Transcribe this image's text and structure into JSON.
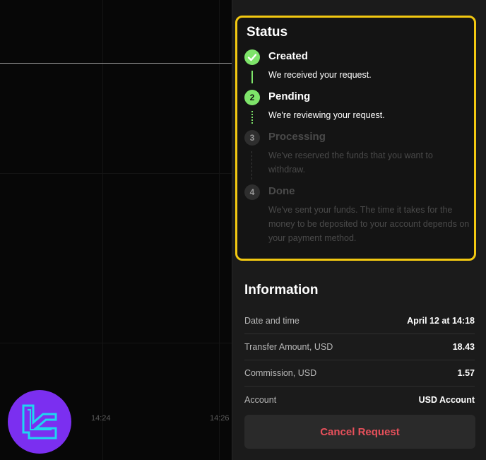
{
  "chart": {
    "time_labels": [
      "14:24",
      "14:26"
    ]
  },
  "status": {
    "title": "Status",
    "steps": [
      {
        "number": "1",
        "title": "Created",
        "desc": "We received your request.",
        "state": "done"
      },
      {
        "number": "2",
        "title": "Pending",
        "desc": "We're reviewing your request.",
        "state": "active"
      },
      {
        "number": "3",
        "title": "Processing",
        "desc": "We've reserved the funds that you want to withdraw.",
        "state": "inactive"
      },
      {
        "number": "4",
        "title": "Done",
        "desc": "We've sent your funds. The time it takes for the money to be deposited to your account depends on your payment method.",
        "state": "inactive"
      }
    ]
  },
  "information": {
    "title": "Information",
    "rows": [
      {
        "label": "Date and time",
        "value": "April 12 at 14:18"
      },
      {
        "label": "Transfer Amount, USD",
        "value": "18.43"
      },
      {
        "label": "Commission, USD",
        "value": "1.57"
      },
      {
        "label": "Account",
        "value": "USD Account"
      }
    ]
  },
  "actions": {
    "cancel_label": "Cancel Request"
  },
  "colors": {
    "highlight": "#f2c811",
    "success": "#7ee46a",
    "danger": "#e8505b",
    "logo_bg": "#7b2ff0",
    "logo_fg": "#1fd6f0"
  },
  "icons": {
    "check": "check-icon",
    "logo": "brand-logo-icon"
  }
}
